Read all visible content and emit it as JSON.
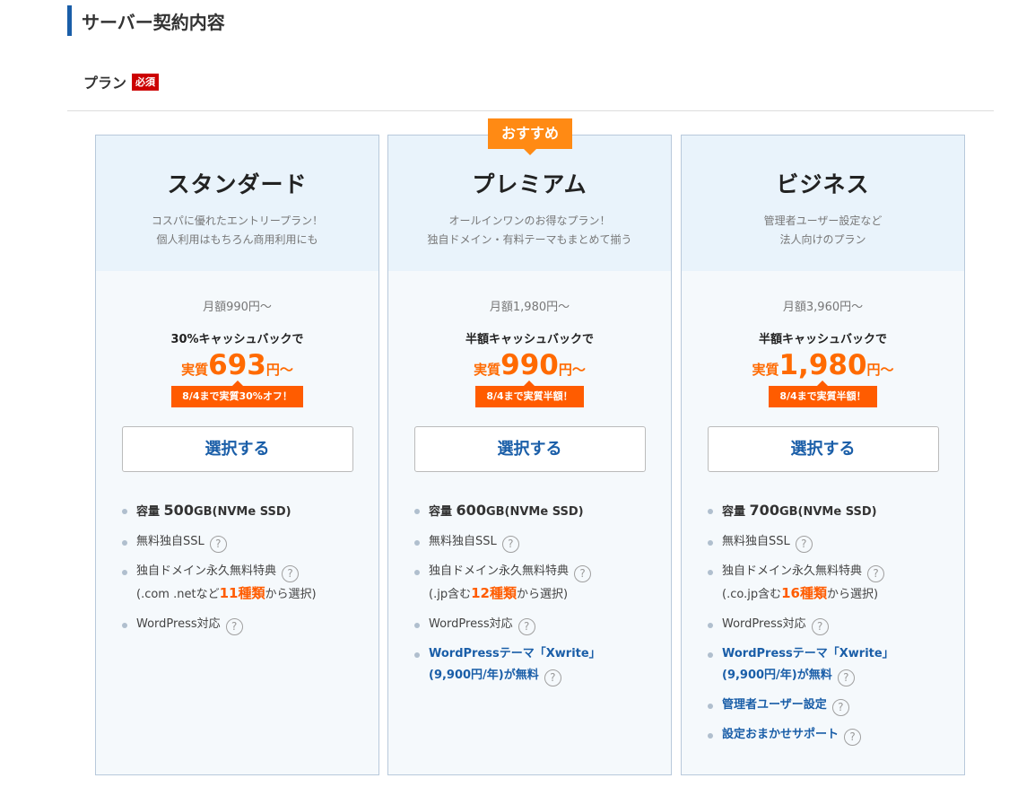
{
  "section": {
    "title": "サーバー契約内容"
  },
  "plan_field": {
    "label": "プラン",
    "required": "必須"
  },
  "recommend_badge": "おすすめ",
  "plans": [
    {
      "name": "スタンダード",
      "desc1": "コスパに優れたエントリープラン！",
      "desc2": "個人利用はもちろん商用利用にも",
      "base_price": "月額990円～",
      "cashback": "30%キャッシュバックで",
      "eff_prefix": "実質",
      "eff_price": "693",
      "eff_suffix": "円～",
      "promo": "8/4まで実質30%オフ！",
      "select": "選択する",
      "capacity_label": "容量",
      "capacity_value": "500",
      "capacity_unit": "GB(NVMe SSD)",
      "ssl": "無料独自SSL",
      "domain_title": "独自ドメイン永久無料特典",
      "domain_pre": "(.com .netなど",
      "domain_count": "11種類",
      "domain_post": "から選択)",
      "wordpress": "WordPress対応"
    },
    {
      "name": "プレミアム",
      "desc1": "オールインワンのお得なプラン！",
      "desc2": "独自ドメイン・有料テーマもまとめて揃う",
      "base_price": "月額1,980円～",
      "cashback": "半額キャッシュバックで",
      "eff_prefix": "実質",
      "eff_price": "990",
      "eff_suffix": "円～",
      "promo": "8/4まで実質半額！",
      "select": "選択する",
      "capacity_label": "容量",
      "capacity_value": "600",
      "capacity_unit": "GB(NVMe SSD)",
      "ssl": "無料独自SSL",
      "domain_title": "独自ドメイン永久無料特典",
      "domain_pre": "(.jp含む",
      "domain_count": "12種類",
      "domain_post": "から選択)",
      "wordpress": "WordPress対応",
      "theme_line1": "WordPressテーマ「Xwrite」",
      "theme_line2": "(9,900円/年)が無料"
    },
    {
      "name": "ビジネス",
      "desc1": "管理者ユーザー設定など",
      "desc2": "法人向けのプラン",
      "base_price": "月額3,960円～",
      "cashback": "半額キャッシュバックで",
      "eff_prefix": "実質",
      "eff_price": "1,980",
      "eff_suffix": "円～",
      "promo": "8/4まで実質半額！",
      "select": "選択する",
      "capacity_label": "容量",
      "capacity_value": "700",
      "capacity_unit": "GB(NVMe SSD)",
      "ssl": "無料独自SSL",
      "domain_title": "独自ドメイン永久無料特典",
      "domain_pre": "(.co.jp含む",
      "domain_count": "16種類",
      "domain_post": "から選択)",
      "wordpress": "WordPress対応",
      "theme_line1": "WordPressテーマ「Xwrite」",
      "theme_line2": "(9,900円/年)が無料",
      "admin": "管理者ユーザー設定",
      "setup": "設定おまかせサポート"
    }
  ],
  "help_glyph": "?",
  "colors": {
    "accent_blue": "#1a5ea8",
    "accent_orange": "#ff5c00",
    "badge_orange": "#ff8a14",
    "required_red": "#cc0000"
  }
}
